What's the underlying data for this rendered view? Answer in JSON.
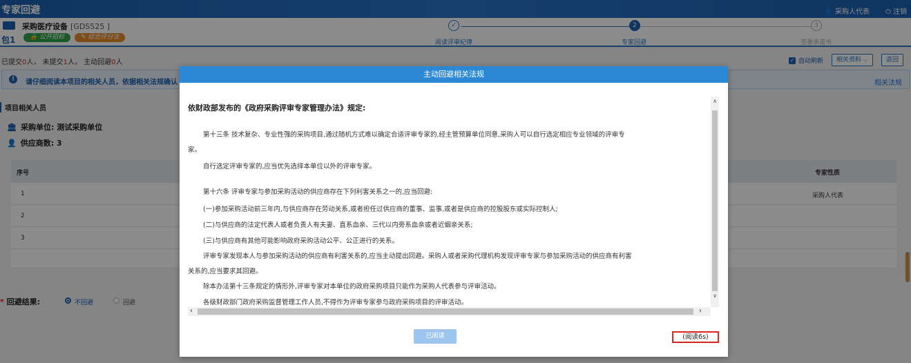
{
  "topbar": {
    "title": "专家回避",
    "user": "采购人代表",
    "logout": "注销"
  },
  "project": {
    "name": "采购医疗设备",
    "code": "[GDS525 ]",
    "package": "包1",
    "badge_open": "公开招标",
    "badge_eval": "综合评分法"
  },
  "steps": [
    {
      "label": "阅读评审纪律",
      "symbol": "✓"
    },
    {
      "label": "专家回避",
      "symbol": "2"
    },
    {
      "label": "签署承诺书",
      "symbol": "3"
    }
  ],
  "status": {
    "prefix": "已提交",
    "submitted": "0",
    "mid1": "人，  未提交",
    "unsubmitted": "1",
    "mid2": "人，  主动回避",
    "avoided": "0",
    "suffix": "人",
    "auto_refresh": "自动刷新",
    "related_docs": "相关资料",
    "back": "返回"
  },
  "info": {
    "message": "请仔细阅读本项目的相关人员，依据相关法规确认",
    "link": "相关法规"
  },
  "section": {
    "title": "项目相关人员",
    "purchaser": "采购单位: 测试采购单位",
    "suppliers": "供应商数: 3"
  },
  "table": {
    "col_index": "序号",
    "col_nature": "专家性质",
    "rows": [
      {
        "index": "1",
        "nature": "采购人代表"
      },
      {
        "index": "2",
        "nature": ""
      },
      {
        "index": "3",
        "nature": ""
      }
    ]
  },
  "result": {
    "label": "回避结果:",
    "option_no": "不回避",
    "option_yes": "回避"
  },
  "modal": {
    "title": "主动回避相关法规",
    "lead": "依财政部发布的《政府采购评审专家管理办法》规定:",
    "lines": [
      "第十三条 技术复杂、专业性强的采购项目,通过随机方式难以确定合适评审专家的,经主管预算单位同意,采购人可以自行选定相应专业领域的评审专",
      "家。",
      "自行选定评审专家的,应当优先选择本单位以外的评审专家。",
      "第十六条 评审专家与参加采购活动的供应商存在下列利害关系之一的,应当回避:",
      "(一)参加采购活动前三年内,与供应商存在劳动关系,或者担任过供应商的董事、监事,或者是供应商的控股股东或实际控制人;",
      "(二)与供应商的法定代表人或者负责人有夫妻、直系血亲、三代以内旁系血亲或者近姻亲关系;",
      "(三)与供应商有其他可能影响政府采购活动公平、公正进行的关系。",
      "评审专家发现本人与参加采购活动的供应商有利害关系的,应当主动提出回避。采购人或者采购代理机构发现评审专家与参加采购活动的供应商有利害",
      "关系的,应当要求其回避。",
      "除本办法第十三条规定的情形外,评审专家对本单位的政府采购项目只能作为采购人代表参与评审活动。",
      "各级财政部门政府采购监督管理工作人员,不得作为评审专家参与政府采购项目的评审活动。"
    ],
    "read_button": "已阅读",
    "countdown": "(阅读6s)"
  }
}
